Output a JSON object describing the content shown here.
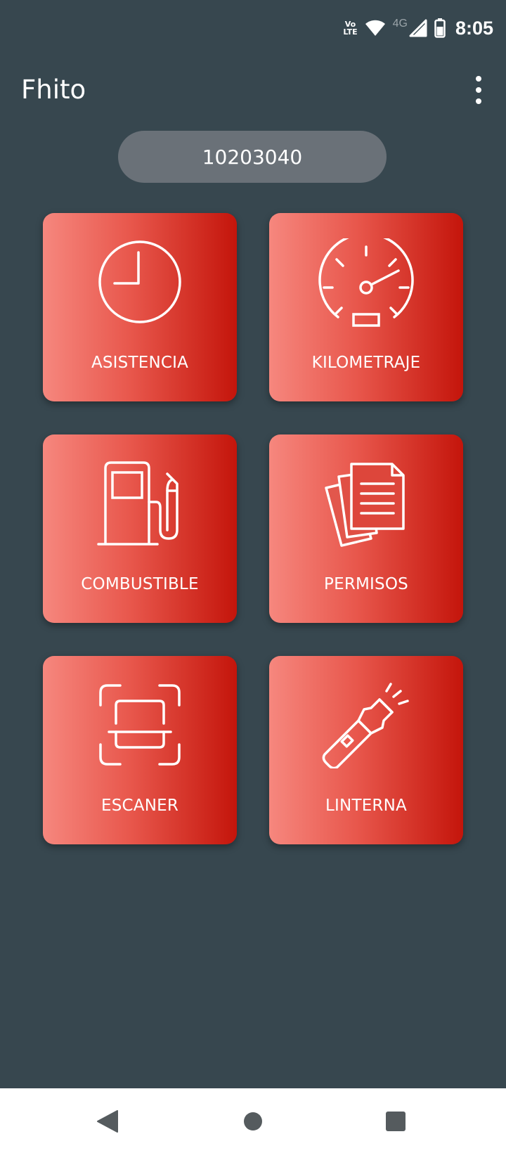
{
  "status_bar": {
    "volte_top": "Vo",
    "volte_bottom": "LTE",
    "network_type": "4G",
    "time": "8:05",
    "icons": [
      "volte-icon",
      "wifi-icon",
      "signal-icon",
      "battery-icon"
    ]
  },
  "app_bar": {
    "title": "Fhito",
    "menu_icon": "more-vert-icon"
  },
  "code_display": {
    "value": "10203040"
  },
  "tiles": [
    {
      "label": "ASISTENCIA",
      "icon": "clock-icon"
    },
    {
      "label": "KILOMETRAJE",
      "icon": "speedometer-icon"
    },
    {
      "label": "COMBUSTIBLE",
      "icon": "fuel-pump-icon"
    },
    {
      "label": "PERMISOS",
      "icon": "documents-icon"
    },
    {
      "label": "ESCANER",
      "icon": "scanner-icon"
    },
    {
      "label": "LINTERNA",
      "icon": "flashlight-icon"
    }
  ],
  "nav_bar": {
    "buttons": [
      "back-icon",
      "home-icon",
      "recents-icon"
    ]
  },
  "colors": {
    "background": "#37474f",
    "pill": "#6a7178",
    "tile_gradient_start": "#f6877e",
    "tile_gradient_end": "#c4150b",
    "nav_bar": "#ffffff"
  }
}
